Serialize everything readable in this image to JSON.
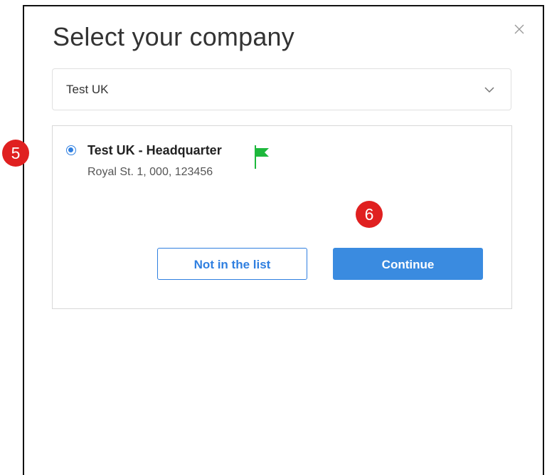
{
  "dialog": {
    "title": "Select your company",
    "close_icon": "close-icon"
  },
  "company_select": {
    "value": "Test UK",
    "icon": "chevron-down-icon"
  },
  "company_option": {
    "name": "Test UK - Headquarter",
    "address": "Royal St. 1, 000, 123456",
    "selected": true,
    "flag_icon": "flag-icon",
    "flag_color": "#1db83c"
  },
  "buttons": {
    "not_in_list": "Not in the list",
    "continue": "Continue"
  },
  "step_markers": [
    "5",
    "6"
  ],
  "colors": {
    "accent": "#2f7fe0",
    "primary_button": "#3a8be0",
    "step_marker": "#e02020"
  }
}
